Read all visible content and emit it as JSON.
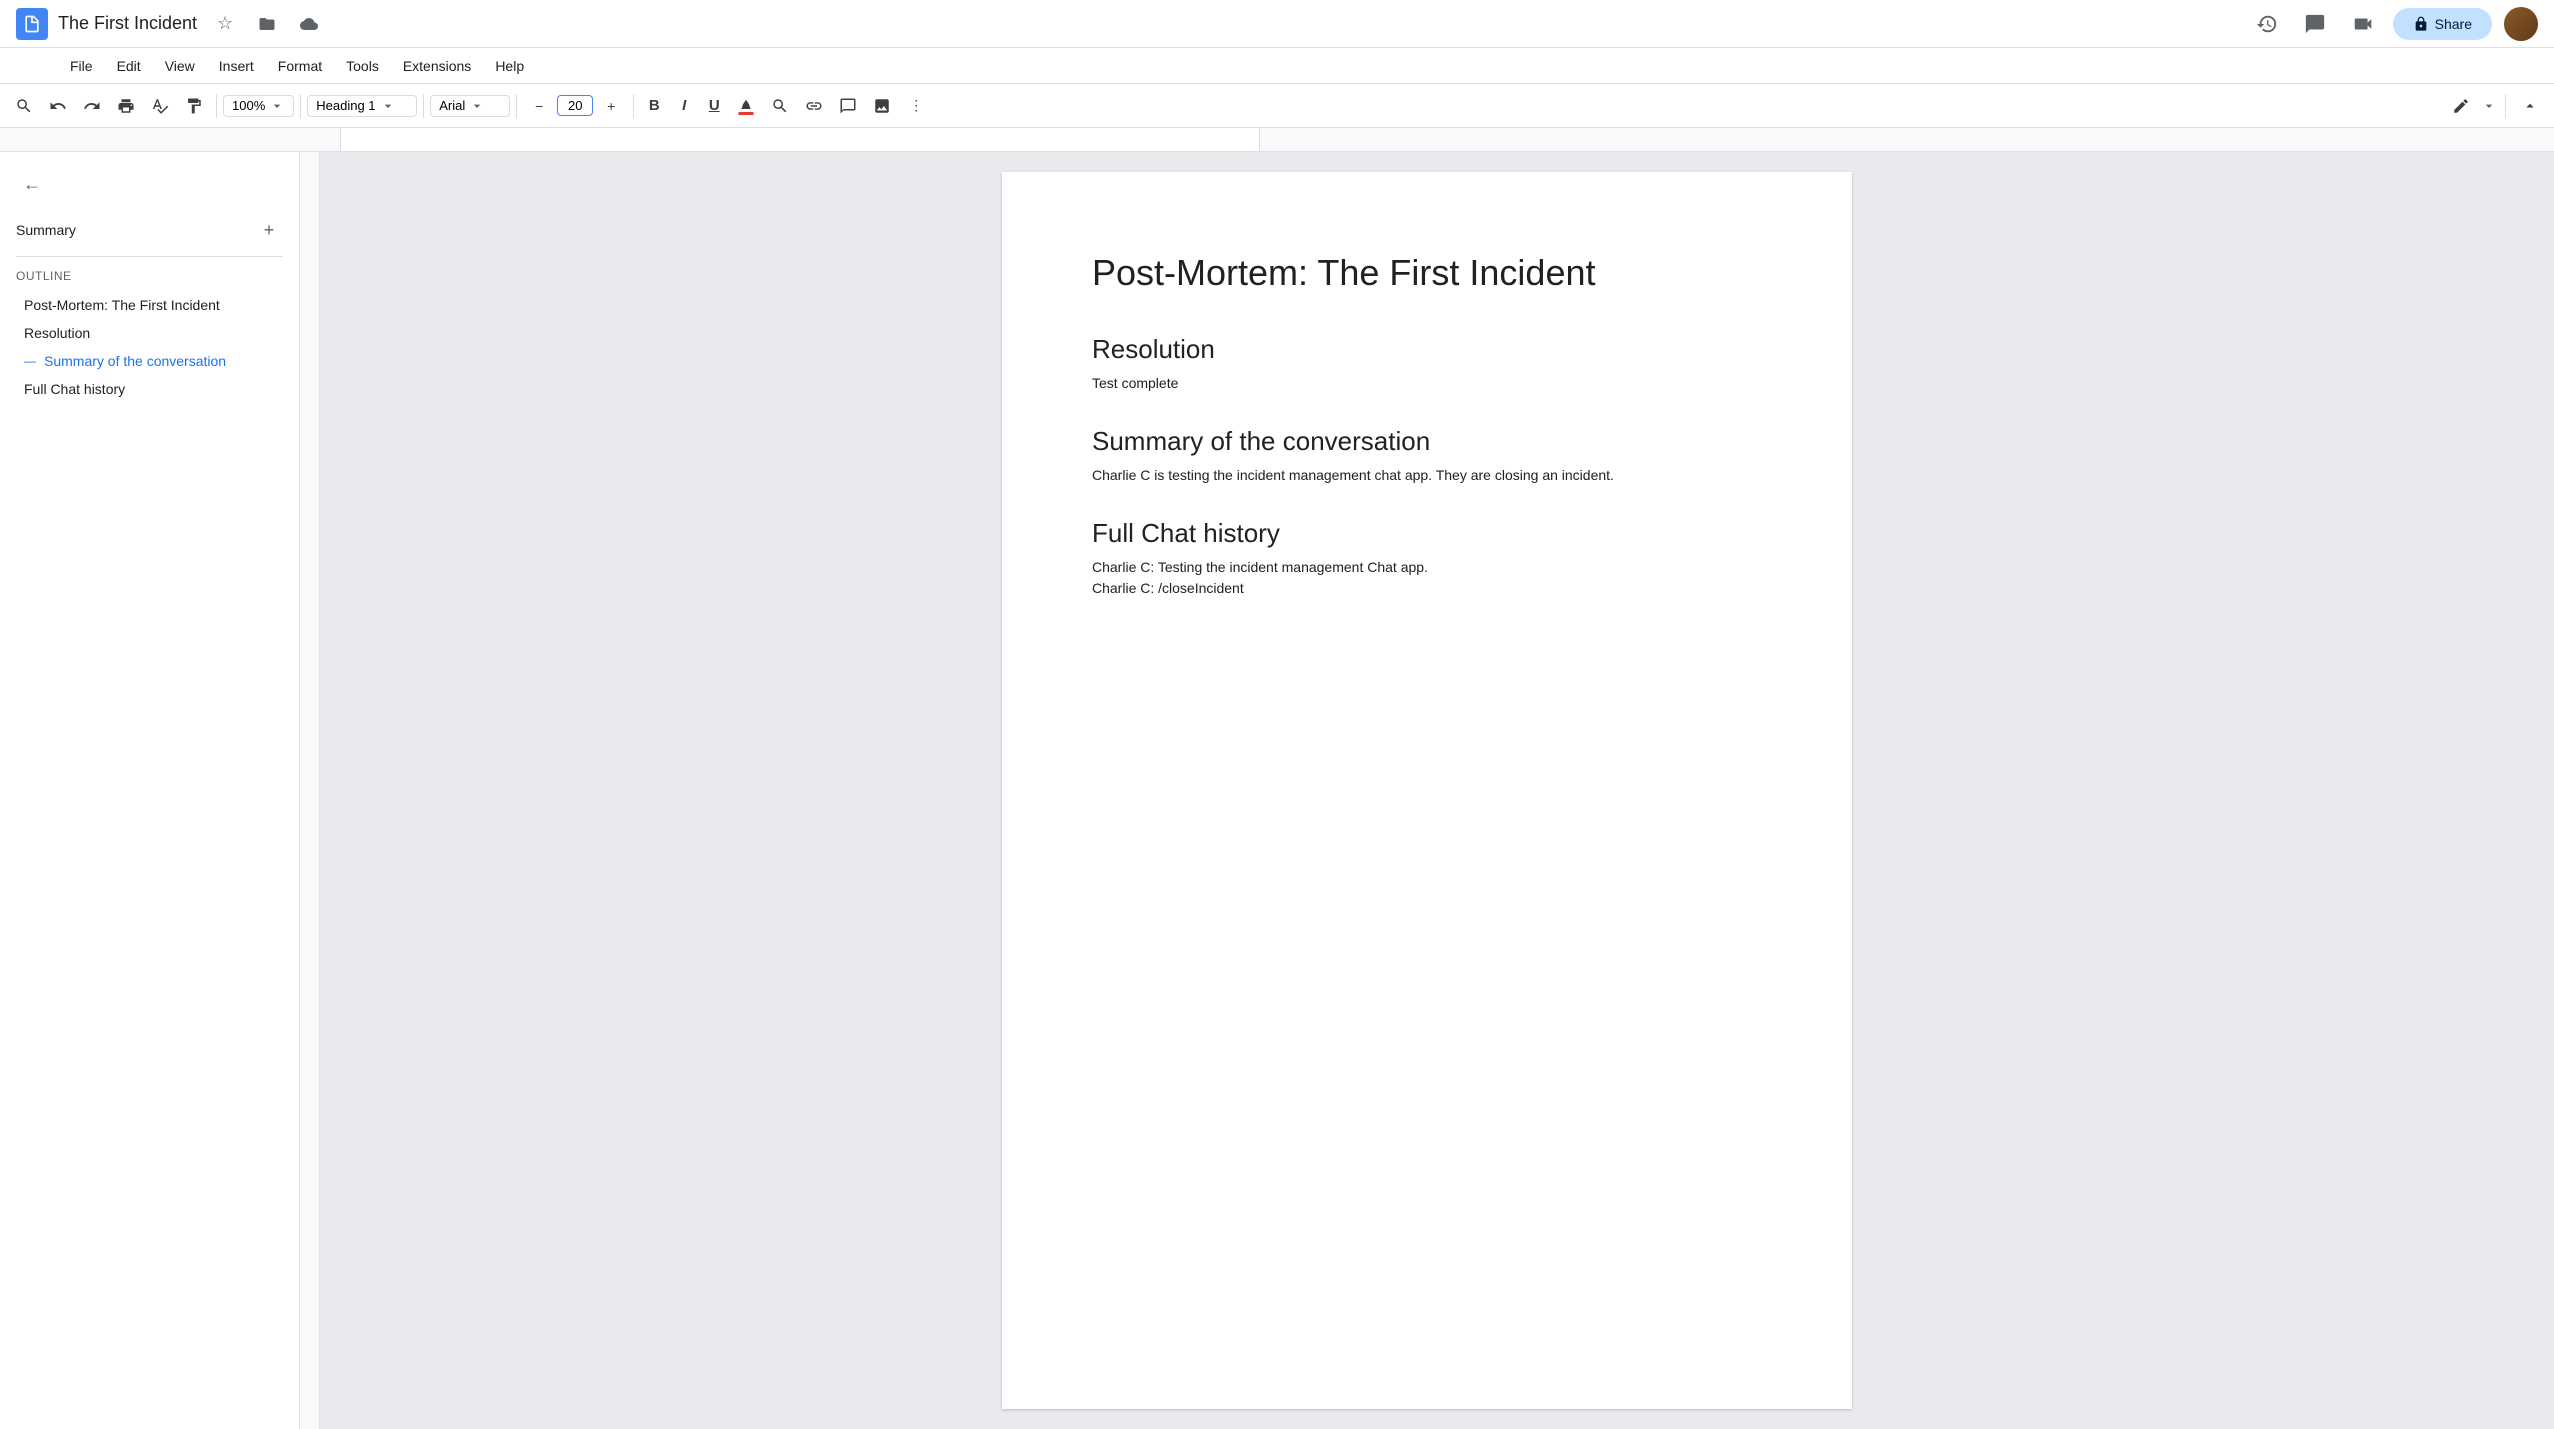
{
  "app": {
    "title": "The First Incident",
    "doc_icon": "document"
  },
  "title_bar": {
    "title": "The First Incident",
    "star_icon": "★",
    "folder_icon": "📁",
    "cloud_icon": "☁",
    "share_label": "Share",
    "history_icon": "history",
    "comment_icon": "comment",
    "videocam_icon": "videocam"
  },
  "menu": {
    "items": [
      "File",
      "Edit",
      "View",
      "Insert",
      "Format",
      "Tools",
      "Extensions",
      "Help"
    ]
  },
  "toolbar": {
    "zoom_label": "100%",
    "style_label": "Heading 1",
    "font_label": "Arial",
    "font_size": "20",
    "bold_label": "B",
    "italic_label": "I",
    "underline_label": "U",
    "more_icon": "⋮",
    "edit_mode_icon": "✏"
  },
  "sidebar": {
    "back_label": "←",
    "summary_label": "Summary",
    "add_icon": "+",
    "outline_label": "Outline",
    "outline_items": [
      {
        "text": "Post-Mortem: The First Incident",
        "active": false
      },
      {
        "text": "Resolution",
        "active": false
      },
      {
        "text": "Summary of the conversation",
        "active": true
      },
      {
        "text": "Full Chat history",
        "active": false
      }
    ]
  },
  "document": {
    "title": "Post-Mortem: The First Incident",
    "sections": [
      {
        "heading": "Resolution",
        "body": "Test complete"
      },
      {
        "heading": "Summary of the conversation",
        "body": "Charlie C is testing the incident management chat app. They are closing an incident."
      },
      {
        "heading": "Full Chat history",
        "lines": [
          "Charlie C: Testing the incident management Chat app.",
          "Charlie C: /closeIncident"
        ]
      }
    ]
  }
}
